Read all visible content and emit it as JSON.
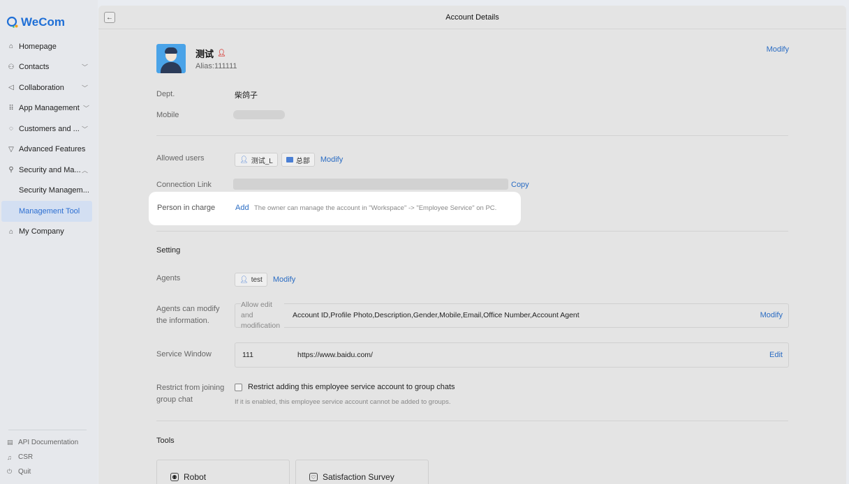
{
  "brand": {
    "name": "WeCom",
    "accent": "#2a6cc3"
  },
  "sidebar": {
    "items": [
      {
        "label": "Homepage",
        "icon": "home-icon"
      },
      {
        "label": "Contacts",
        "icon": "contacts-icon"
      },
      {
        "label": "Collaboration",
        "icon": "collaboration-icon"
      },
      {
        "label": "App Management",
        "icon": "apps-icon"
      },
      {
        "label": "Customers and ...",
        "icon": "customers-icon"
      },
      {
        "label": "Advanced Features",
        "icon": "advanced-icon"
      },
      {
        "label": "Security and Ma...",
        "icon": "security-icon"
      },
      {
        "label": "Security Managem...",
        "icon": ""
      },
      {
        "label": "Management Tool",
        "icon": ""
      },
      {
        "label": "My Company",
        "icon": "company-icon"
      }
    ],
    "footer": [
      {
        "label": "API Documentation",
        "icon": "doc-icon"
      },
      {
        "label": "CSR",
        "icon": "headset-icon"
      },
      {
        "label": "Quit",
        "icon": "power-icon"
      }
    ]
  },
  "header": {
    "title": "Account Details"
  },
  "profile": {
    "name": "测试",
    "alias": "Alias:111111",
    "modify": "Modify"
  },
  "details": {
    "dept_label": "Dept.",
    "dept_value": "柴鸽子",
    "mobile_label": "Mobile",
    "allowed_label": "Allowed users",
    "allowed_chips": [
      "测试_L",
      "总部"
    ],
    "allowed_modify": "Modify",
    "connection_label": "Connection Link",
    "copy": "Copy",
    "person_label": "Person in charge",
    "person_add": "Add",
    "person_note": "The owner can manage the account in \"Workspace\" -> \"Employee Service\" on PC."
  },
  "setting": {
    "title": "Setting",
    "agents_label": "Agents",
    "agents_chip": "test",
    "agents_modify": "Modify",
    "modify_info_label": "Agents can modify the information.",
    "allow_edit_legend": "Allow edit and modification",
    "allow_edit_value": "Account ID,Profile Photo,Description,Gender,Mobile,Email,Office Number,Account Agent",
    "allow_edit_modify": "Modify",
    "service_label": "Service Window",
    "service_name": "111",
    "service_url": "https://www.baidu.com/",
    "service_edit": "Edit",
    "restrict_label": "Restrict from joining group chat",
    "restrict_checkbox": "Restrict adding this employee service account to group chats",
    "restrict_note": "If it is enabled, this employee service account cannot be added to groups."
  },
  "tools": {
    "title": "Tools",
    "items": [
      "Robot",
      "Satisfaction Survey"
    ]
  }
}
